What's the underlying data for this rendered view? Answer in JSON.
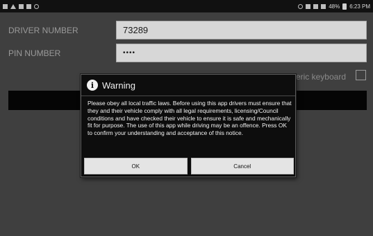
{
  "status_bar": {
    "battery": "48%",
    "time": "6:23 PM",
    "left_icons": [
      "image-icon",
      "warning-icon",
      "email-icon",
      "document-icon",
      "sync-icon"
    ],
    "right_icons": [
      "location-icon",
      "bluetooth-icon",
      "wifi-icon",
      "signal-icon",
      "battery-icon"
    ]
  },
  "form": {
    "driver_number_label": "DRIVER NUMBER",
    "driver_number_value": "73289",
    "pin_number_label": "PIN NUMBER",
    "pin_number_value": "••••",
    "numeric_keyboard_label": "Use numeric keyboard",
    "numeric_keyboard_checked": false
  },
  "dialog": {
    "title": "Warning",
    "icon": "info-icon",
    "message": "Please obey all local traffic laws. Before using this app drivers must ensure that they and their vehicle comply with all legal requirements, licensing/Council conditions and have checked their vehicle to ensure it is safe and mechanically fit for purpose. The use of this app while driving may be an offence.  Press OK to confirm your understanding and acceptance of this notice.",
    "ok_label": "OK",
    "cancel_label": "Cancel"
  }
}
